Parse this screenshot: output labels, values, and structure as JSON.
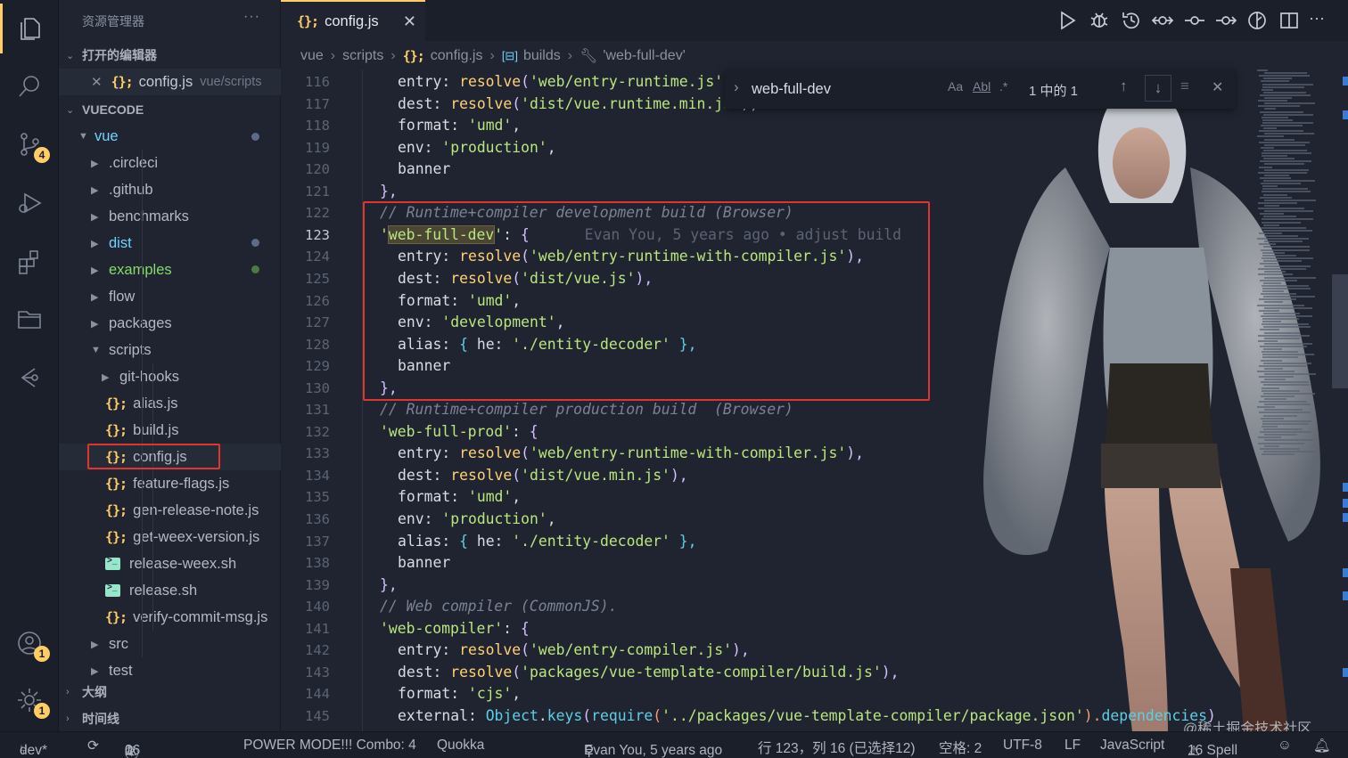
{
  "sidebar": {
    "title": "资源管理器",
    "more": "···",
    "open_editors_label": "打开的编辑器",
    "open_editor": {
      "name": "config.js",
      "path": "vue/scripts"
    },
    "workspace_label": "VUECODE",
    "root_folder": "vue",
    "items": [
      {
        "label": ".circleci"
      },
      {
        "label": ".github"
      },
      {
        "label": "benchmarks"
      },
      {
        "label": "dist"
      },
      {
        "label": "examples"
      },
      {
        "label": "flow"
      },
      {
        "label": "packages"
      },
      {
        "label": "scripts"
      },
      {
        "label": "git-hooks"
      },
      {
        "label": "alias.js"
      },
      {
        "label": "build.js"
      },
      {
        "label": "config.js"
      },
      {
        "label": "feature-flags.js"
      },
      {
        "label": "gen-release-note.js"
      },
      {
        "label": "get-weex-version.js"
      },
      {
        "label": "release-weex.sh"
      },
      {
        "label": "release.sh"
      },
      {
        "label": "verify-commit-msg.js"
      },
      {
        "label": "src"
      },
      {
        "label": "test"
      }
    ],
    "outline_label": "大纲",
    "timeline_label": "时间线"
  },
  "activity": {
    "scm_badge": "4",
    "accounts_badge": "1",
    "settings_badge": "1"
  },
  "tab": {
    "label": "config.js",
    "icon": "{};"
  },
  "breadcrumb": {
    "items": [
      "vue",
      "scripts",
      "config.js",
      "builds",
      "'web-full-dev'"
    ]
  },
  "find": {
    "query": "web-full-dev",
    "match_case": "Aa",
    "whole_word": "Abl",
    "regex": ".*",
    "result": "1 中的 1"
  },
  "editor": {
    "current_line": "123",
    "blame": "Evan You, 5 years ago • adjust build",
    "lines": [
      {
        "n": "116",
        "code": [
          {
            "t": "entry: ",
            "c": ""
          },
          {
            "t": "resolve",
            "c": "fn"
          },
          {
            "t": "(",
            "c": "br2"
          },
          {
            "t": "'web/entry-runtime.js'",
            "c": "str"
          },
          {
            "t": "),",
            "c": "br2"
          }
        ],
        "i": 1
      },
      {
        "n": "117",
        "code": [
          {
            "t": "dest: ",
            "c": ""
          },
          {
            "t": "resolve",
            "c": "fn"
          },
          {
            "t": "(",
            "c": "br2"
          },
          {
            "t": "'dist/vue.runtime.min.js'",
            "c": "str"
          },
          {
            "t": "),",
            "c": "br2"
          }
        ],
        "i": 1
      },
      {
        "n": "118",
        "code": [
          {
            "t": "format: ",
            "c": ""
          },
          {
            "t": "'umd'",
            "c": "str"
          },
          {
            "t": ",",
            "c": ""
          }
        ],
        "i": 1
      },
      {
        "n": "119",
        "code": [
          {
            "t": "env: ",
            "c": ""
          },
          {
            "t": "'production'",
            "c": "str"
          },
          {
            "t": ",",
            "c": ""
          }
        ],
        "i": 1
      },
      {
        "n": "120",
        "code": [
          {
            "t": "banner",
            "c": ""
          }
        ],
        "i": 1
      },
      {
        "n": "121",
        "code": [
          {
            "t": "},",
            "c": "br2"
          }
        ],
        "i": 0
      },
      {
        "n": "122",
        "code": [
          {
            "t": "// Runtime+compiler development build (Browser)",
            "c": "cm"
          }
        ],
        "i": 0
      },
      {
        "n": "123",
        "code": [
          {
            "t": "'",
            "c": "str"
          },
          {
            "t": "web-full-dev",
            "c": "str hl"
          },
          {
            "t": "'",
            "c": "str"
          },
          {
            "t": ": ",
            "c": ""
          },
          {
            "t": "{",
            "c": "br2"
          }
        ],
        "i": 0
      },
      {
        "n": "124",
        "code": [
          {
            "t": "entry: ",
            "c": ""
          },
          {
            "t": "resolve",
            "c": "fn"
          },
          {
            "t": "(",
            "c": "br2"
          },
          {
            "t": "'web/entry-runtime-with-compiler.js'",
            "c": "str"
          },
          {
            "t": "),",
            "c": "br2"
          }
        ],
        "i": 1
      },
      {
        "n": "125",
        "code": [
          {
            "t": "dest: ",
            "c": ""
          },
          {
            "t": "resolve",
            "c": "fn"
          },
          {
            "t": "(",
            "c": "br2"
          },
          {
            "t": "'dist/vue.js'",
            "c": "str"
          },
          {
            "t": "),",
            "c": "br2"
          }
        ],
        "i": 1
      },
      {
        "n": "126",
        "code": [
          {
            "t": "format: ",
            "c": ""
          },
          {
            "t": "'umd'",
            "c": "str"
          },
          {
            "t": ",",
            "c": ""
          }
        ],
        "i": 1
      },
      {
        "n": "127",
        "code": [
          {
            "t": "env: ",
            "c": ""
          },
          {
            "t": "'development'",
            "c": "str"
          },
          {
            "t": ",",
            "c": ""
          }
        ],
        "i": 1
      },
      {
        "n": "128",
        "code": [
          {
            "t": "alias: ",
            "c": ""
          },
          {
            "t": "{",
            "c": "obj"
          },
          {
            "t": " he: ",
            "c": ""
          },
          {
            "t": "'./entity-decoder'",
            "c": "str"
          },
          {
            "t": " },",
            "c": "obj"
          }
        ],
        "i": 1
      },
      {
        "n": "129",
        "code": [
          {
            "t": "banner",
            "c": ""
          }
        ],
        "i": 1
      },
      {
        "n": "130",
        "code": [
          {
            "t": "},",
            "c": "br2"
          }
        ],
        "i": 0
      },
      {
        "n": "131",
        "code": [
          {
            "t": "// Runtime+compiler production build  (Browser)",
            "c": "cm"
          }
        ],
        "i": 0
      },
      {
        "n": "132",
        "code": [
          {
            "t": "'web-full-prod'",
            "c": "str"
          },
          {
            "t": ": ",
            "c": ""
          },
          {
            "t": "{",
            "c": "br2"
          }
        ],
        "i": 0
      },
      {
        "n": "133",
        "code": [
          {
            "t": "entry: ",
            "c": ""
          },
          {
            "t": "resolve",
            "c": "fn"
          },
          {
            "t": "(",
            "c": "br2"
          },
          {
            "t": "'web/entry-runtime-with-compiler.js'",
            "c": "str"
          },
          {
            "t": "),",
            "c": "br2"
          }
        ],
        "i": 1
      },
      {
        "n": "134",
        "code": [
          {
            "t": "dest: ",
            "c": ""
          },
          {
            "t": "resolve",
            "c": "fn"
          },
          {
            "t": "(",
            "c": "br2"
          },
          {
            "t": "'dist/vue.min.js'",
            "c": "str"
          },
          {
            "t": "),",
            "c": "br2"
          }
        ],
        "i": 1
      },
      {
        "n": "135",
        "code": [
          {
            "t": "format: ",
            "c": ""
          },
          {
            "t": "'umd'",
            "c": "str"
          },
          {
            "t": ",",
            "c": ""
          }
        ],
        "i": 1
      },
      {
        "n": "136",
        "code": [
          {
            "t": "env: ",
            "c": ""
          },
          {
            "t": "'production'",
            "c": "str"
          },
          {
            "t": ",",
            "c": ""
          }
        ],
        "i": 1
      },
      {
        "n": "137",
        "code": [
          {
            "t": "alias: ",
            "c": ""
          },
          {
            "t": "{",
            "c": "obj"
          },
          {
            "t": " he: ",
            "c": ""
          },
          {
            "t": "'./entity-decoder'",
            "c": "str"
          },
          {
            "t": " },",
            "c": "obj"
          }
        ],
        "i": 1
      },
      {
        "n": "138",
        "code": [
          {
            "t": "banner",
            "c": ""
          }
        ],
        "i": 1
      },
      {
        "n": "139",
        "code": [
          {
            "t": "},",
            "c": "br2"
          }
        ],
        "i": 0
      },
      {
        "n": "140",
        "code": [
          {
            "t": "// Web compiler (CommonJS).",
            "c": "cm"
          }
        ],
        "i": 0
      },
      {
        "n": "141",
        "code": [
          {
            "t": "'web-compiler'",
            "c": "str"
          },
          {
            "t": ": ",
            "c": ""
          },
          {
            "t": "{",
            "c": "br2"
          }
        ],
        "i": 0
      },
      {
        "n": "142",
        "code": [
          {
            "t": "entry: ",
            "c": ""
          },
          {
            "t": "resolve",
            "c": "fn"
          },
          {
            "t": "(",
            "c": "br2"
          },
          {
            "t": "'web/entry-compiler.js'",
            "c": "str"
          },
          {
            "t": "),",
            "c": "br2"
          }
        ],
        "i": 1
      },
      {
        "n": "143",
        "code": [
          {
            "t": "dest: ",
            "c": ""
          },
          {
            "t": "resolve",
            "c": "fn"
          },
          {
            "t": "(",
            "c": "br2"
          },
          {
            "t": "'packages/vue-template-compiler/build.js'",
            "c": "str"
          },
          {
            "t": "),",
            "c": "br2"
          }
        ],
        "i": 1
      },
      {
        "n": "144",
        "code": [
          {
            "t": "format: ",
            "c": ""
          },
          {
            "t": "'cjs'",
            "c": "str"
          },
          {
            "t": ",",
            "c": ""
          }
        ],
        "i": 1
      },
      {
        "n": "145",
        "code": [
          {
            "t": "external: ",
            "c": ""
          },
          {
            "t": "Object",
            "c": "obj"
          },
          {
            "t": ".",
            "c": ""
          },
          {
            "t": "keys",
            "c": "obj"
          },
          {
            "t": "(",
            "c": "br2"
          },
          {
            "t": "require",
            "c": "obj"
          },
          {
            "t": "(",
            "c": "br1"
          },
          {
            "t": "'../packages/vue-template-compiler/package.json'",
            "c": "str"
          },
          {
            "t": ").",
            "c": "br1"
          },
          {
            "t": "dependencies",
            "c": "obj"
          },
          {
            "t": ")",
            "c": "br2"
          }
        ],
        "i": 1
      }
    ]
  },
  "watermark": "@稀土掘金技术社区",
  "status": {
    "branch": "dev*",
    "errors": "0",
    "warnings": "0",
    "infos": "16",
    "power_mode": "POWER MODE!!! Combo: 4",
    "quokka": "Quokka",
    "blame": "Evan You, 5 years ago",
    "position": "行 123，列 16 (已选择12)",
    "spaces": "空格: 2",
    "encoding": "UTF-8",
    "eol": "LF",
    "language": "JavaScript",
    "spell": "16 Spell"
  }
}
